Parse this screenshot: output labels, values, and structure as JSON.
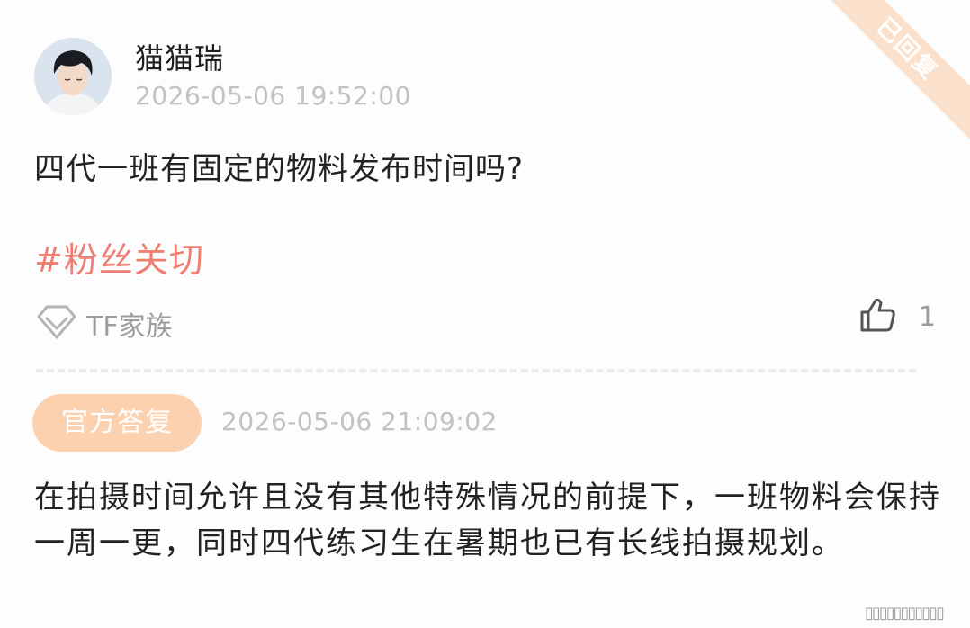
{
  "post": {
    "author": "猫猫瑞",
    "timestamp": "2026-05-06 19:52:00",
    "status_ribbon": "已回复",
    "question": "四代一班有固定的物料发布时间吗?",
    "hashtag": "#粉丝关切",
    "community": "TF家族",
    "like_count": "1"
  },
  "reply": {
    "badge": "官方答复",
    "timestamp": "2026-05-06 21:09:02",
    "text": "在拍摄时间允许且没有其他特殊情况的前提下，一班物料会保持一周一更，同时四代练习生在暑期也已有长线拍摄规划。"
  },
  "colors": {
    "accent_hashtag": "#ee7f72",
    "badge_bg": "#fcd1b0",
    "ribbon_bg": "#fbe1cc",
    "meta_gray": "#c2c2c2"
  },
  "icons": {
    "community": "diamond-logo-icon",
    "like": "thumbs-up-icon"
  },
  "watermark": "▯▯▯▯▯▯▯▯▯▯▯"
}
